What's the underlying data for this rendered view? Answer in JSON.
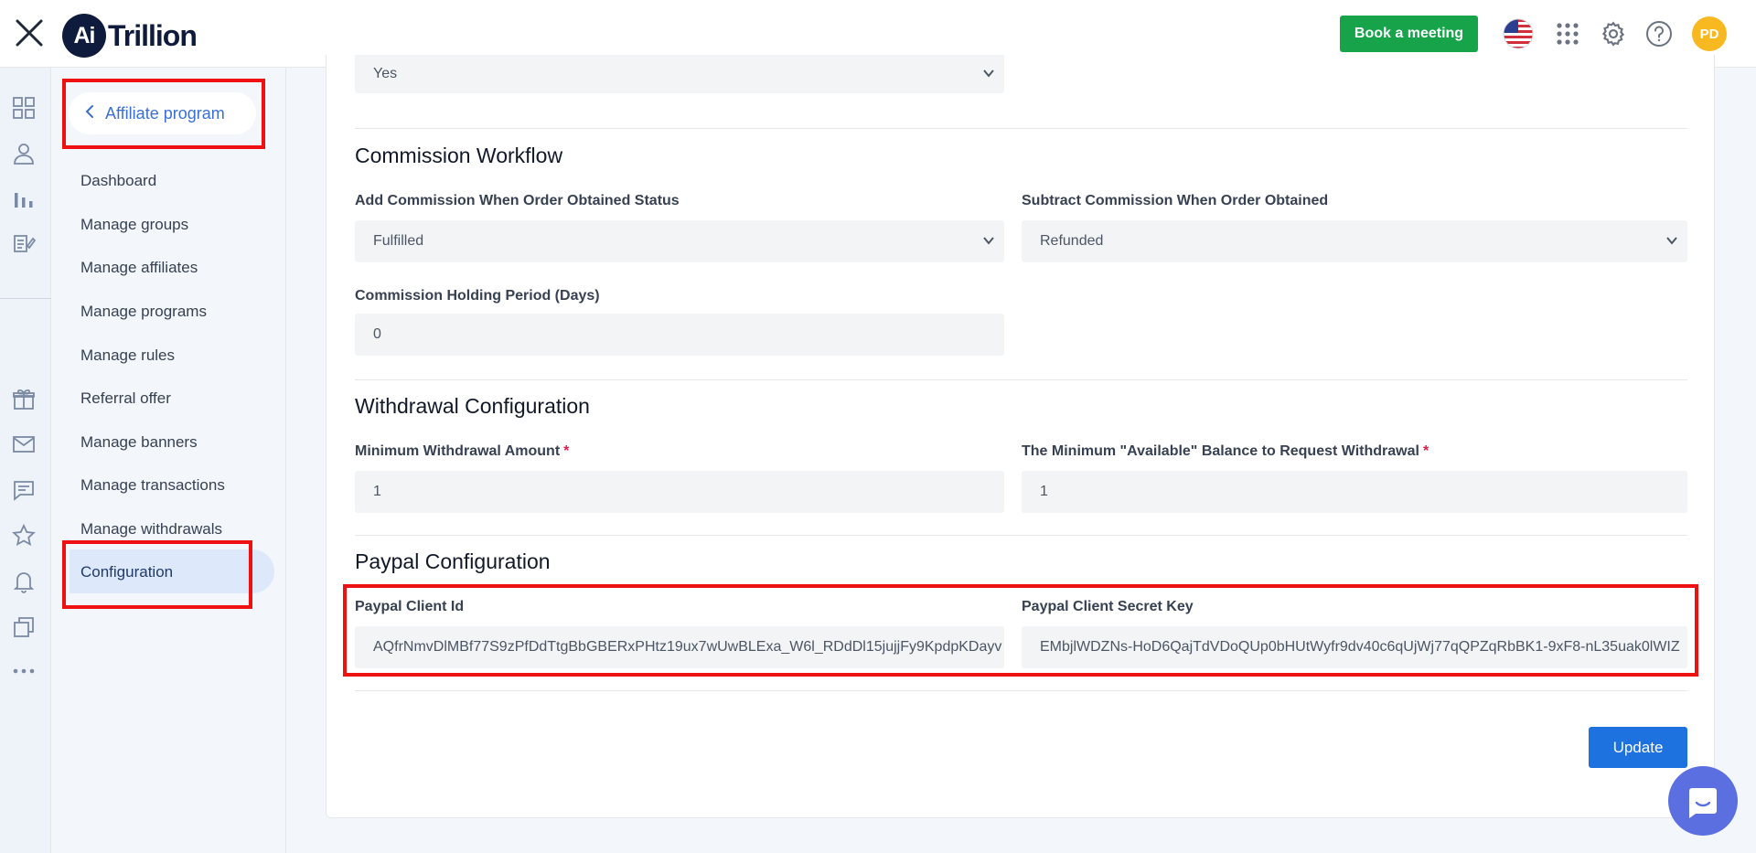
{
  "header": {
    "logo_mark": "Ai",
    "logo_text": "Trillion",
    "book_meeting_label": "Book a meeting",
    "avatar_initials": "PD"
  },
  "sidebar": {
    "back_label": "Affiliate program",
    "items": [
      {
        "label": "Dashboard"
      },
      {
        "label": "Manage groups"
      },
      {
        "label": "Manage affiliates"
      },
      {
        "label": "Manage programs"
      },
      {
        "label": "Manage rules"
      },
      {
        "label": "Referral offer"
      },
      {
        "label": "Manage banners"
      },
      {
        "label": "Manage transactions"
      },
      {
        "label": "Manage withdrawals"
      },
      {
        "label": "Configuration"
      }
    ],
    "active_item": "Configuration"
  },
  "main": {
    "top_select_value": "Yes",
    "commission_workflow": {
      "title": "Commission Workflow",
      "add_label": "Add Commission When Order Obtained Status",
      "add_value": "Fulfilled",
      "subtract_label": "Subtract Commission When Order Obtained",
      "subtract_value": "Refunded",
      "holding_label": "Commission Holding Period (Days)",
      "holding_value": "0"
    },
    "withdrawal_configuration": {
      "title": "Withdrawal Configuration",
      "min_amount_label": "Minimum Withdrawal Amount",
      "min_amount_value": "1",
      "min_balance_label": "The Minimum \"Available\" Balance to Request Withdrawal",
      "min_balance_value": "1",
      "required_mark": "*"
    },
    "paypal_configuration": {
      "title": "Paypal Configuration",
      "client_id_label": "Paypal Client Id",
      "client_id_value": "AQfrNmvDlMBf77S9zPfDdTtgBbGBERxPHtz19ux7wUwBLExa_W6l_RDdDl15jujjFy9KpdpKDayv",
      "secret_label": "Paypal Client Secret Key",
      "secret_value": "EMbjlWDZNs-HoD6QajTdVDoQUp0bHUtWyfr9dv40c6qUjWj77qQPZqRbBK1-9xF8-nL35uak0lWIZ"
    },
    "update_label": "Update"
  },
  "colors": {
    "brand_navy": "#0f1b3d",
    "book_green": "#16a34a",
    "primary_blue": "#1d72e0",
    "annotation_red": "#ee1111",
    "avatar_yellow": "#f8b81f"
  },
  "icons": {
    "top": [
      "close-icon",
      "us-flag-icon",
      "apps-grid-icon",
      "gear-icon",
      "help-icon"
    ],
    "rail": [
      "dashboard-icon",
      "user-icon",
      "bar-chart-icon",
      "edit-list-icon",
      "gift-icon",
      "mail-icon",
      "chat-icon",
      "star-icon",
      "bell-icon",
      "copy-icon",
      "more-icon"
    ]
  }
}
